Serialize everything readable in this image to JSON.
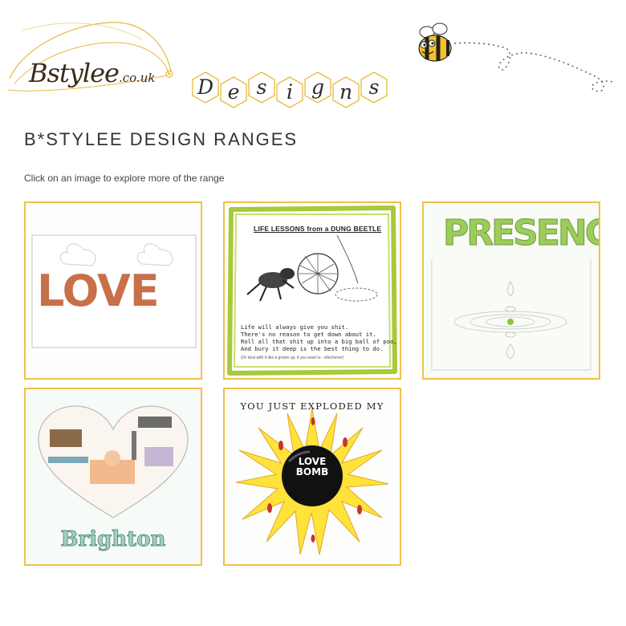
{
  "header": {
    "logo_text": "Bstylee",
    "logo_domain": ".co.uk",
    "designs_letters": [
      "D",
      "e",
      "s",
      "i",
      "g",
      "n",
      "s"
    ]
  },
  "main": {
    "title": "B*STYLEE DESIGN RANGES",
    "intro": "Click on an image to explore more of the range"
  },
  "tiles": [
    {
      "artwork_text": "LOVE"
    },
    {
      "artwork_title": "LIFE LESSONS from a DUNG BEETLE",
      "poem": [
        "Life will always give you shit.",
        "There's no reason to get down about it.",
        "Roll all that shit up into a big ball of poo,",
        "And bury it deep is the best thing to do."
      ],
      "footnote": "(Or deal with it like a grown up, if you want to - whichever)"
    },
    {
      "artwork_text": "PRESENCE"
    },
    {
      "artwork_text": "Brighton"
    },
    {
      "artwork_line": "YOU JUST EXPLODED MY",
      "bomb_line1": "LOVE",
      "bomb_line2": "BOMB"
    }
  ],
  "colors": {
    "tile_border": "#efc14a",
    "title_text": "#333333",
    "beetle_frame": "#a8c93a",
    "sun_yellow": "#ffe23a"
  }
}
